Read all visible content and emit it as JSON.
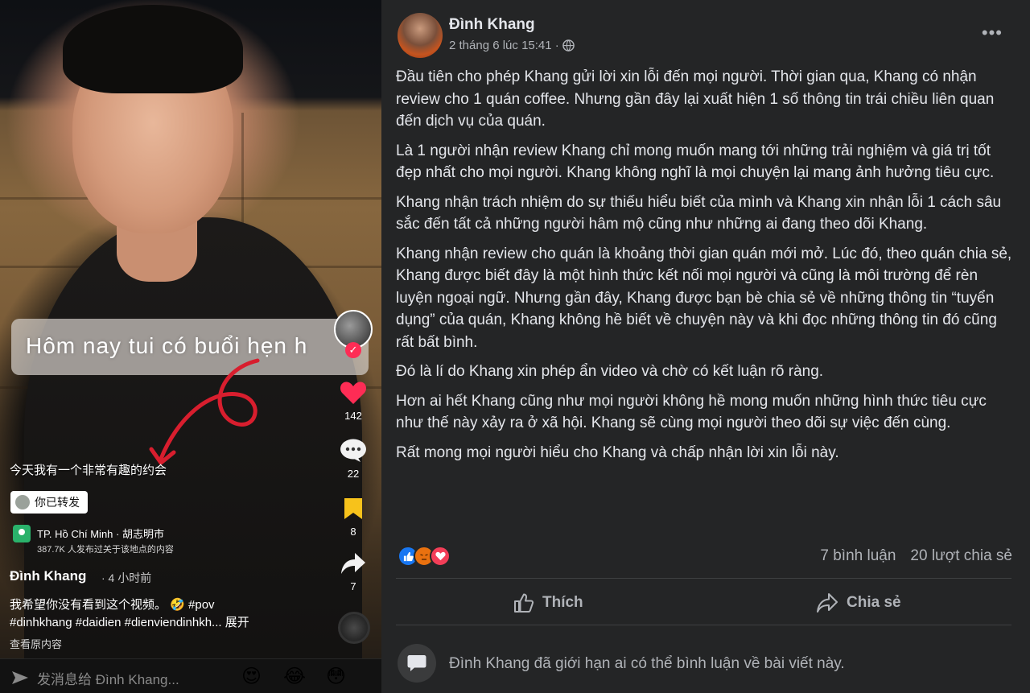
{
  "video": {
    "caption_overlay": "Hôm nay tui có buổi hẹn h",
    "likes": "142",
    "comments": "22",
    "saves": "8",
    "shares": "7",
    "subtitle_zh": "今天我有一个非常有趣的约会",
    "repost_chip": "你已转发",
    "location": "TP. Hồ Chí Minh · 胡志明市",
    "location_sub": "387.7K 人发布过关于该地点的内容",
    "author": "Đình Khang",
    "time_ago": "· 4 小时前",
    "description_line1": "我希望你没有看到这个视频。 🤣 #pov",
    "description_line2": "#dinhkhang #daidien #dienviendinhkh... 展开",
    "view_original": "查看原内容",
    "message_placeholder": "发消息给 Đình Khang...",
    "emoji_1": "😍",
    "emoji_2": "😂",
    "emoji_3": "😳"
  },
  "post": {
    "author": "Đình Khang",
    "timestamp": "2 tháng 6 lúc 15:41 ·",
    "more_label": "•••",
    "paragraphs": [
      "Đầu tiên cho phép Khang gửi lời xin lỗi đến mọi người. Thời gian qua, Khang có nhận review cho 1 quán coffee. Nhưng gần đây lại xuất hiện 1 số thông tin trái chiều liên quan đến dịch vụ của quán.",
      "Là 1 người nhận review Khang chỉ mong muốn mang tới những trải nghiệm và giá trị tốt đẹp nhất  cho mọi người. Khang không nghĩ là mọi chuyện lại mang ảnh hưởng tiêu cực.",
      "Khang nhận trách nhiệm do sự thiếu hiểu biết của mình và Khang xin nhận lỗi 1 cách sâu sắc đến tất cả những người hâm mộ cũng như những ai đang theo dõi Khang.",
      "Khang nhận review cho quán là khoảng thời gian quán mới mở. Lúc đó, theo quán chia sẻ, Khang được biết đây là một hình thức kết nối mọi người và cũng là môi trường để rèn luyện ngoại ngữ. Nhưng gần đây, Khang được bạn bè chia sẻ về những thông tin “tuyển dụng” của quán, Khang không hề biết về chuyện này và khi đọc những thông tin đó cũng rất bất bình.",
      "Đó là lí do Khang xin phép ẩn video và chờ có kết luận rõ ràng.",
      "Hơn ai hết Khang cũng như mọi người không hề mong muốn những hình thức tiêu cực như thế này xảy ra ở xã hội. Khang sẽ cùng mọi người theo dõi sự việc đến cùng.",
      "Rất mong mọi người hiểu cho Khang và chấp nhận lời xin lỗi này."
    ],
    "comment_count": "7 bình luận",
    "share_count": "20 lượt chia sẻ",
    "like_label": "Thích",
    "share_label": "Chia sẻ",
    "restricted_notice": "Đình Khang đã giới hạn ai có thể bình luận về bài viết này."
  },
  "colors": {
    "fb_bg": "#242526",
    "fb_text": "#e4e6eb",
    "fb_muted": "#b0b3b8",
    "like_red": "#fe2c55",
    "save_yellow": "#f7c21b",
    "reaction_like": "#1877f2",
    "reaction_angry": "#e9710f",
    "reaction_love": "#f33e58"
  }
}
